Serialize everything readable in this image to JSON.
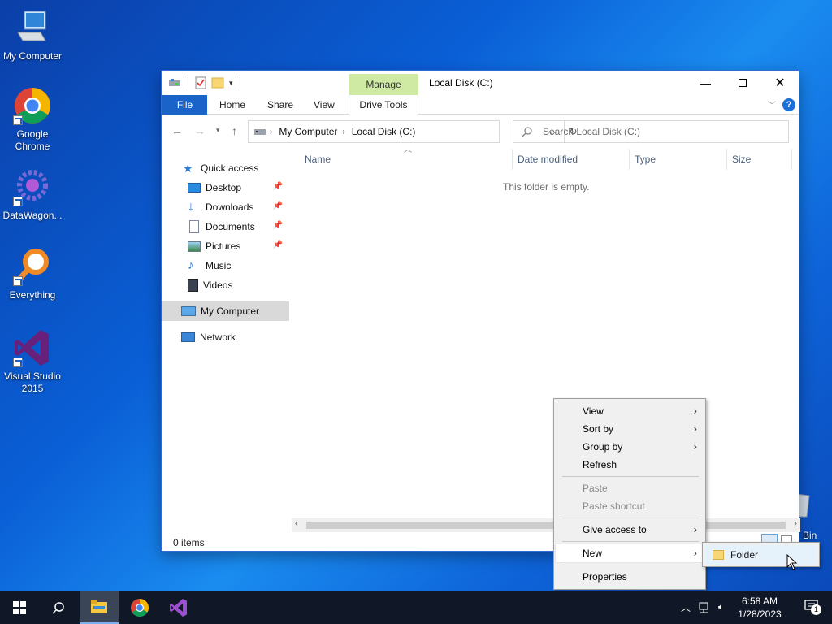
{
  "desktop": {
    "icons": [
      {
        "label": "My Computer"
      },
      {
        "label": "Google\nChrome"
      },
      {
        "label": "DataWagon..."
      },
      {
        "label": "Everything"
      },
      {
        "label": "Visual Studio\n2015"
      }
    ],
    "recycle_bin_partial": "Bin"
  },
  "window": {
    "title": "Local Disk (C:)",
    "contextual_group": "Manage",
    "tabs": {
      "file": "File",
      "home": "Home",
      "share": "Share",
      "view": "View",
      "drive_tools": "Drive Tools"
    },
    "help": "?",
    "address": {
      "crumbs": [
        "My Computer",
        "Local Disk (C:)"
      ]
    },
    "search": {
      "placeholder": "Search Local Disk (C:)"
    },
    "nav": {
      "quick_access": "Quick access",
      "items": [
        {
          "label": "Desktop",
          "pinned": true
        },
        {
          "label": "Downloads",
          "pinned": true
        },
        {
          "label": "Documents",
          "pinned": true
        },
        {
          "label": "Pictures",
          "pinned": true
        },
        {
          "label": "Music",
          "pinned": false
        },
        {
          "label": "Videos",
          "pinned": false
        }
      ],
      "my_computer": "My Computer",
      "network": "Network"
    },
    "columns": [
      "Name",
      "Date modified",
      "Type",
      "Size"
    ],
    "empty_message": "This folder is empty.",
    "status": "0 items"
  },
  "context_menu": {
    "view": "View",
    "sort_by": "Sort by",
    "group_by": "Group by",
    "refresh": "Refresh",
    "paste": "Paste",
    "paste_shortcut": "Paste shortcut",
    "give_access": "Give access to",
    "new": "New",
    "properties": "Properties"
  },
  "submenu": {
    "folder": "Folder"
  },
  "taskbar": {
    "time": "6:58 AM",
    "date": "1/28/2023",
    "notification_count": "1"
  },
  "colors": {
    "accent": "#1a64c9",
    "manage_tab": "#cfeaa3",
    "taskbar": "#101828"
  }
}
